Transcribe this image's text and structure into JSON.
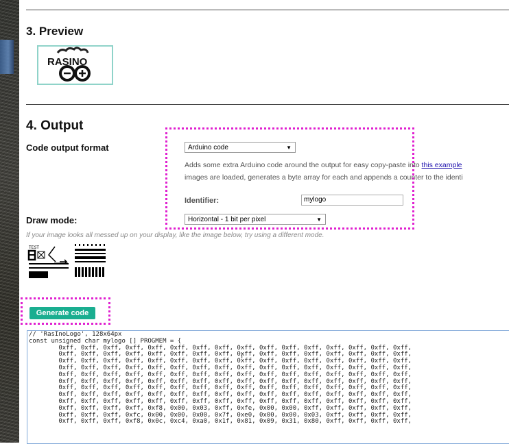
{
  "preview": {
    "title": "3. Preview",
    "logo_text": "RASINO"
  },
  "output": {
    "title": "4. Output",
    "code_format_label": "Code output format",
    "code_format_value": "Arduino code",
    "description_1": "Adds some extra Arduino code around the output for easy copy-paste into ",
    "description_link": "this example",
    "description_2": "images are loaded, generates a byte array for each and appends a counter to the identi",
    "identifier_label": "Identifier:",
    "identifier_value": "mylogo",
    "draw_mode_label": "Draw mode:",
    "draw_mode_value": "Horizontal - 1 bit per pixel",
    "hint": "If your image looks all messed up on your display, like the image below, try using a different mode.",
    "generate_button": "Generate code"
  },
  "code": {
    "lines": [
      "// 'RasInoLogo', 128x64px",
      "const unsigned char mylogo [] PROGMEM = {",
      "\t0xff, 0xff, 0xff, 0xff, 0xff, 0xff, 0xff, 0xff, 0xff, 0xff, 0xff, 0xff, 0xff, 0xff, 0xff, 0xff,",
      "\t0xff, 0xff, 0xff, 0xff, 0xff, 0xff, 0xff, 0xff, 0xff, 0xff, 0xff, 0xff, 0xff, 0xff, 0xff, 0xff,",
      "\t0xff, 0xff, 0xff, 0xff, 0xff, 0xff, 0xff, 0xff, 0xff, 0xff, 0xff, 0xff, 0xff, 0xff, 0xff, 0xff,",
      "\t0xff, 0xff, 0xff, 0xff, 0xff, 0xff, 0xff, 0xff, 0xff, 0xff, 0xff, 0xff, 0xff, 0xff, 0xff, 0xff,",
      "\t0xff, 0xff, 0xff, 0xff, 0xff, 0xff, 0xff, 0xff, 0xff, 0xff, 0xff, 0xff, 0xff, 0xff, 0xff, 0xff,",
      "\t0xff, 0xff, 0xff, 0xff, 0xff, 0xff, 0xff, 0xff, 0xff, 0xff, 0xff, 0xff, 0xff, 0xff, 0xff, 0xff,",
      "\t0xff, 0xff, 0xff, 0xff, 0xff, 0xff, 0xff, 0xff, 0xff, 0xff, 0xff, 0xff, 0xff, 0xff, 0xff, 0xff,",
      "\t0xff, 0xff, 0xff, 0xff, 0xff, 0xff, 0xff, 0xff, 0xff, 0xff, 0xff, 0xff, 0xff, 0xff, 0xff, 0xff,",
      "\t0xff, 0xff, 0xff, 0xff, 0xff, 0xff, 0xff, 0xff, 0xff, 0xff, 0xff, 0xff, 0xff, 0xff, 0xff, 0xff,",
      "\t0xff, 0xff, 0xff, 0xff, 0xf8, 0x00, 0x03, 0xff, 0xfe, 0x00, 0x00, 0xff, 0xff, 0xff, 0xff, 0xff,",
      "\t0xff, 0xff, 0xff, 0xfc, 0x00, 0x00, 0x00, 0x7f, 0xe0, 0x00, 0x00, 0x03, 0xff, 0xff, 0xff, 0xff,",
      "\t0xff, 0xff, 0xff, 0xf8, 0x0c, 0xc4, 0xa0, 0x1f, 0x81, 0x09, 0x31, 0x80, 0xff, 0xff, 0xff, 0xff,"
    ]
  }
}
